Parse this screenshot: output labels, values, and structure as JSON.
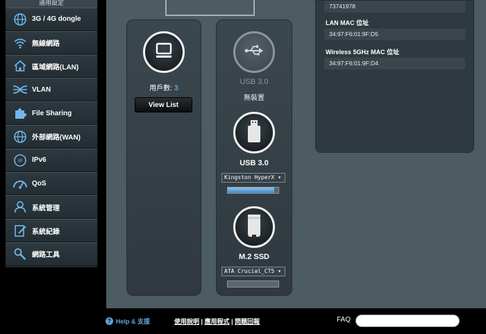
{
  "sidebar": {
    "header": "通用設定",
    "items": [
      {
        "label": "3G / 4G dongle",
        "icon": "globe-icon"
      },
      {
        "label": "無線網路",
        "icon": "wifi-icon"
      },
      {
        "label": "區域網路(LAN)",
        "icon": "home-icon"
      },
      {
        "label": "VLAN",
        "icon": "vlan-icon"
      },
      {
        "label": "File Sharing",
        "icon": "puzzle-icon"
      },
      {
        "label": "外部網路(WAN)",
        "icon": "globe-icon"
      },
      {
        "label": "IPv6",
        "icon": "ipv6-icon"
      },
      {
        "label": "QoS",
        "icon": "gauge-icon"
      },
      {
        "label": "系統管理",
        "icon": "user-icon"
      },
      {
        "label": "系統紀錄",
        "icon": "log-icon"
      },
      {
        "label": "網路工具",
        "icon": "tools-icon"
      }
    ]
  },
  "clients": {
    "label": "用戶數:",
    "count": "3",
    "view_list": "View List"
  },
  "usb": {
    "top_title": "USB 3.0",
    "top_status": "無裝置",
    "usb_title": "USB 3.0",
    "usb_device": "Kingston HyperX ▾",
    "usb_usage": 0.92,
    "ssd_title": "M.2 SSD",
    "ssd_device": "ATA Crucial_CT5 ▾",
    "ssd_usage": 0.0
  },
  "info": {
    "first_value": "73741978",
    "lan_mac_label": "LAN MAC 位址",
    "lan_mac": "34:97:F6:01:9F:D5",
    "wifi5_mac_label": "Wireless 5GHz MAC 位址",
    "wifi5_mac": "34:97:F6:01:9F:D4"
  },
  "footer": {
    "help": "Help & 支援",
    "link_manual": "使用說明",
    "sep1": " | ",
    "link_app": "應用程式",
    "sep2": " | ",
    "link_faq": "問題回報",
    "faq": "FAQ"
  },
  "colors": {
    "accent": "#5fa2d6",
    "sidebar_bg": "#1f2a30",
    "panel_bg": "#4d5b63"
  }
}
